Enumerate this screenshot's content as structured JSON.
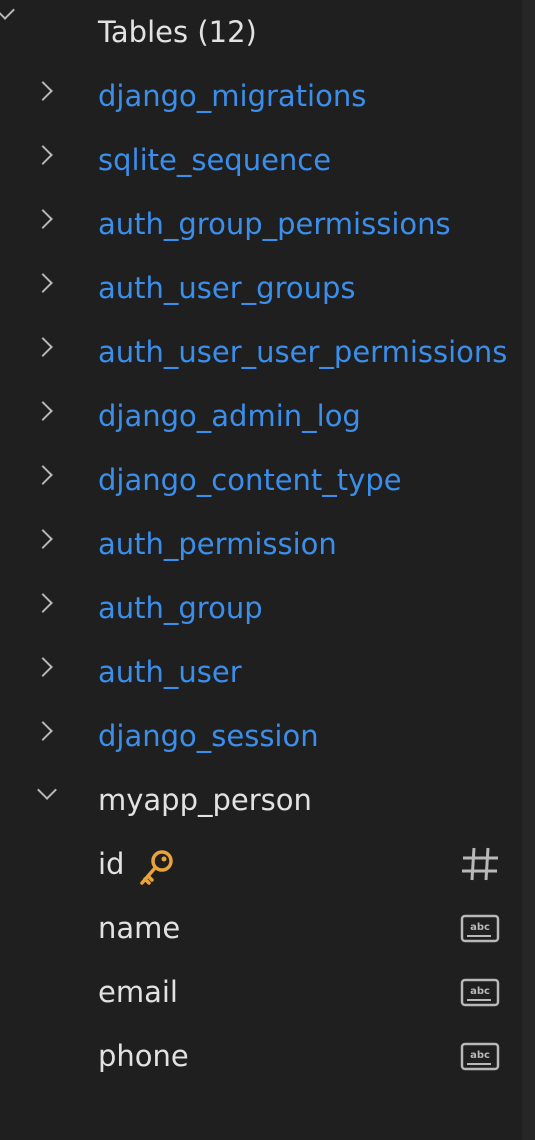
{
  "tree": {
    "group_label": "Tables (12)",
    "tables": [
      {
        "name": "django_migrations"
      },
      {
        "name": "sqlite_sequence"
      },
      {
        "name": "auth_group_permissions"
      },
      {
        "name": "auth_user_groups"
      },
      {
        "name": "auth_user_user_permissions"
      },
      {
        "name": "django_admin_log"
      },
      {
        "name": "django_content_type"
      },
      {
        "name": "auth_permission"
      },
      {
        "name": "auth_group"
      },
      {
        "name": "auth_user"
      },
      {
        "name": "django_session"
      },
      {
        "name": "myapp_person"
      }
    ],
    "expanded_table": {
      "name": "myapp_person",
      "columns": [
        {
          "name": "id",
          "type_icon": "hash-icon",
          "primary_key": true
        },
        {
          "name": "name",
          "type_icon": "text-abc-icon"
        },
        {
          "name": "email",
          "type_icon": "text-abc-icon"
        },
        {
          "name": "phone",
          "type_icon": "text-abc-icon"
        }
      ]
    }
  },
  "colors": {
    "background": "#1f1f1f",
    "table_link": "#3b8eea",
    "text": "#e2e2e2",
    "key_icon": "#e8a33a",
    "icon_gray": "#b8b8b8"
  }
}
